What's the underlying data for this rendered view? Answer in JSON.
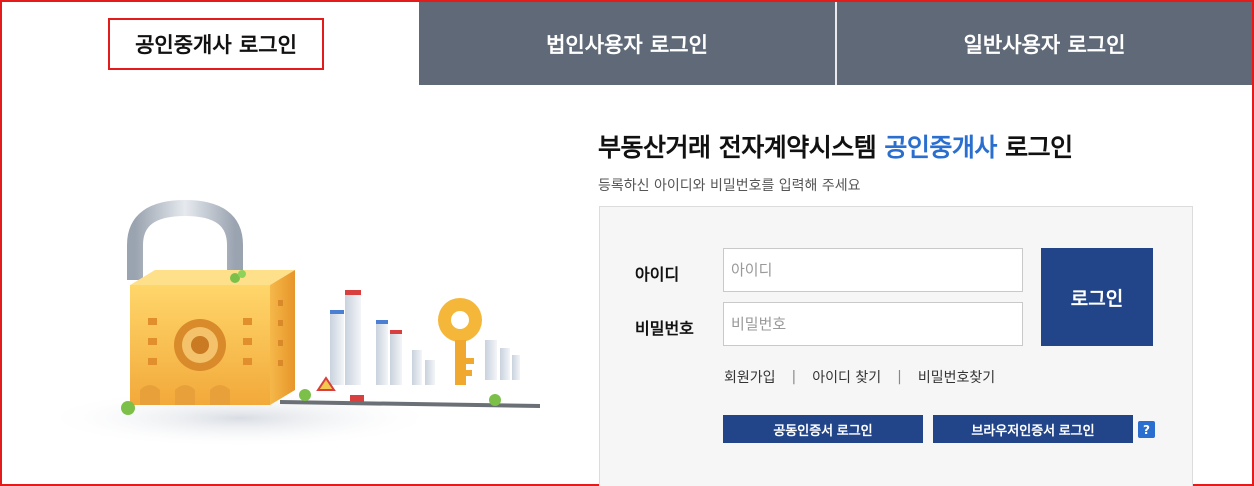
{
  "tabs": [
    {
      "label": "공인중개사 로그인",
      "active": true
    },
    {
      "label": "법인사용자 로그인",
      "active": false
    },
    {
      "label": "일반사용자 로그인",
      "active": false
    }
  ],
  "heading": {
    "prefix": "부동산거래 전자계약시스템 ",
    "highlight": "공인중개사",
    "suffix": " 로그인"
  },
  "subtitle": "등록하신 아이디와 비밀번호를 입력해 주세요",
  "form": {
    "id_label": "아이디",
    "id_placeholder": "아이디",
    "pw_label": "비밀번호",
    "pw_placeholder": "비밀번호",
    "login_button": "로그인"
  },
  "links": {
    "signup": "회원가입",
    "find_id": "아이디 찾기",
    "find_pw": "비밀번호찾기",
    "separator": "|"
  },
  "cert": {
    "joint_cert": "공동인증서 로그인",
    "browser_cert": "브라우저인증서 로그인",
    "help": "?"
  },
  "colors": {
    "primary": "#22458a",
    "highlight": "#2a6fcf",
    "tab_inactive": "#5f6977",
    "frame": "#e31b1b"
  }
}
